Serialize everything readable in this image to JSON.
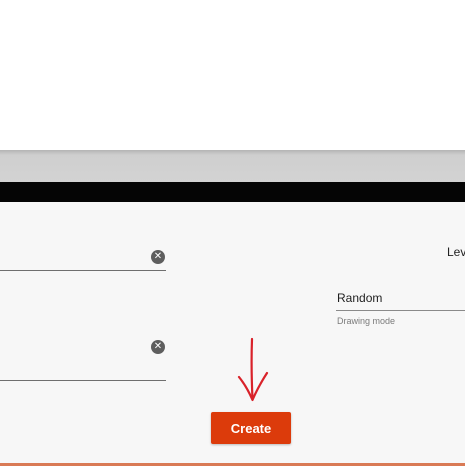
{
  "form": {
    "level_label": "Lev",
    "drawing_mode": {
      "value": "Random",
      "helper_text": "Drawing mode"
    },
    "create_label": "Create",
    "clear_symbol": "✕"
  },
  "colors": {
    "accent": "#dc3b0b",
    "annotation_arrow": "#d9222a",
    "panel_background": "#f7f7f7",
    "top_bar": "#050505"
  },
  "icons": {
    "clear_field": "clear-icon",
    "annotation": "down-arrow-annotation"
  }
}
